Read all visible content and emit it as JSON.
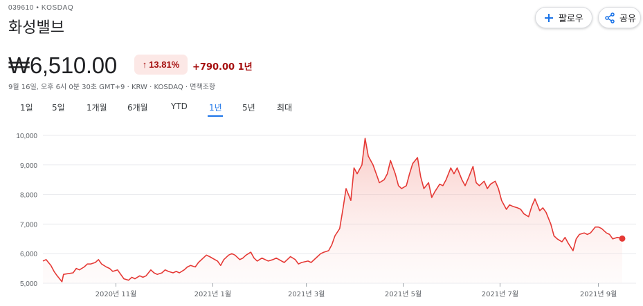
{
  "header": {
    "ticker": "039610 • KOSDAQ",
    "company": "화성밸브",
    "follow_label": "팔로우",
    "share_label": "공유"
  },
  "quote": {
    "price": "₩6,510.00",
    "percent": "13.81%",
    "change": "+790.00 1년",
    "timestamp": "9월 16일, 오후 6시 0분 30초 GMT+9 · KRW · KOSDAQ · 면책조항"
  },
  "tabs": [
    {
      "label": "1일",
      "active": false
    },
    {
      "label": "5일",
      "active": false
    },
    {
      "label": "1개월",
      "active": false
    },
    {
      "label": "6개월",
      "active": false
    },
    {
      "label": "YTD",
      "active": false
    },
    {
      "label": "1년",
      "active": true
    },
    {
      "label": "5년",
      "active": false
    },
    {
      "label": "최대",
      "active": false
    }
  ],
  "icons": {
    "follow": "plus-icon",
    "share": "share-icon",
    "trend": "arrow-up-icon"
  },
  "colors": {
    "line": "#e53935",
    "fill": "#fce8e6",
    "negative_text": "#a50e0e",
    "active_tab": "#1a73e8"
  },
  "chart_data": {
    "type": "area",
    "ylim": [
      5000,
      10000
    ],
    "yticks": [
      5000,
      6000,
      7000,
      8000,
      9000,
      10000
    ],
    "ytick_labels": [
      "5,000",
      "6,000",
      "7,000",
      "8,000",
      "9,000",
      "10,000"
    ],
    "xlim": [
      "2020-09-16",
      "2021-09-16"
    ],
    "xticks": [
      {
        "date": "2020-11-01",
        "label": "2020년 11월"
      },
      {
        "date": "2021-01-01",
        "label": "2021년 1월"
      },
      {
        "date": "2021-03-01",
        "label": "2021년 3월"
      },
      {
        "date": "2021-05-01",
        "label": "2021년 5월"
      },
      {
        "date": "2021-07-01",
        "label": "2021년 7월"
      },
      {
        "date": "2021-09-01",
        "label": "2021년 9월"
      }
    ],
    "grid": true,
    "series": [
      {
        "points": [
          [
            "2020-09-16",
            5750
          ],
          [
            "2020-09-18",
            5800
          ],
          [
            "2020-09-21",
            5600
          ],
          [
            "2020-09-23",
            5400
          ],
          [
            "2020-09-25",
            5250
          ],
          [
            "2020-09-28",
            5050
          ],
          [
            "2020-09-29",
            5300
          ],
          [
            "2020-10-05",
            5350
          ],
          [
            "2020-10-07",
            5500
          ],
          [
            "2020-10-09",
            5450
          ],
          [
            "2020-10-12",
            5550
          ],
          [
            "2020-10-14",
            5650
          ],
          [
            "2020-10-16",
            5650
          ],
          [
            "2020-10-19",
            5700
          ],
          [
            "2020-10-21",
            5800
          ],
          [
            "2020-10-23",
            5650
          ],
          [
            "2020-10-26",
            5550
          ],
          [
            "2020-10-28",
            5500
          ],
          [
            "2020-10-30",
            5400
          ],
          [
            "2020-11-02",
            5450
          ],
          [
            "2020-11-04",
            5300
          ],
          [
            "2020-11-06",
            5150
          ],
          [
            "2020-11-09",
            5100
          ],
          [
            "2020-11-11",
            5200
          ],
          [
            "2020-11-13",
            5150
          ],
          [
            "2020-11-16",
            5250
          ],
          [
            "2020-11-18",
            5200
          ],
          [
            "2020-11-20",
            5250
          ],
          [
            "2020-11-23",
            5450
          ],
          [
            "2020-11-25",
            5350
          ],
          [
            "2020-11-27",
            5300
          ],
          [
            "2020-11-30",
            5350
          ],
          [
            "2020-12-02",
            5450
          ],
          [
            "2020-12-04",
            5400
          ],
          [
            "2020-12-07",
            5350
          ],
          [
            "2020-12-09",
            5400
          ],
          [
            "2020-12-11",
            5350
          ],
          [
            "2020-12-14",
            5450
          ],
          [
            "2020-12-16",
            5550
          ],
          [
            "2020-12-18",
            5600
          ],
          [
            "2020-12-21",
            5550
          ],
          [
            "2020-12-23",
            5700
          ],
          [
            "2020-12-28",
            5950
          ],
          [
            "2020-12-30",
            5900
          ],
          [
            "2021-01-04",
            5750
          ],
          [
            "2021-01-06",
            5600
          ],
          [
            "2021-01-08",
            5800
          ],
          [
            "2021-01-11",
            5950
          ],
          [
            "2021-01-13",
            6000
          ],
          [
            "2021-01-15",
            5950
          ],
          [
            "2021-01-18",
            5800
          ],
          [
            "2021-01-20",
            5850
          ],
          [
            "2021-01-22",
            5950
          ],
          [
            "2021-01-25",
            6050
          ],
          [
            "2021-01-27",
            5850
          ],
          [
            "2021-01-29",
            5750
          ],
          [
            "2021-02-01",
            5850
          ],
          [
            "2021-02-03",
            5800
          ],
          [
            "2021-02-05",
            5750
          ],
          [
            "2021-02-08",
            5800
          ],
          [
            "2021-02-10",
            5850
          ],
          [
            "2021-02-15",
            5700
          ],
          [
            "2021-02-17",
            5800
          ],
          [
            "2021-02-19",
            5900
          ],
          [
            "2021-02-22",
            5800
          ],
          [
            "2021-02-24",
            5650
          ],
          [
            "2021-02-26",
            5700
          ],
          [
            "2021-03-02",
            5750
          ],
          [
            "2021-03-04",
            5700
          ],
          [
            "2021-03-08",
            5900
          ],
          [
            "2021-03-10",
            6000
          ],
          [
            "2021-03-12",
            6050
          ],
          [
            "2021-03-15",
            6100
          ],
          [
            "2021-03-17",
            6300
          ],
          [
            "2021-03-19",
            6600
          ],
          [
            "2021-03-22",
            6850
          ],
          [
            "2021-03-24",
            7500
          ],
          [
            "2021-03-26",
            8200
          ],
          [
            "2021-03-29",
            7800
          ],
          [
            "2021-03-31",
            8900
          ],
          [
            "2021-04-02",
            8700
          ],
          [
            "2021-04-05",
            9000
          ],
          [
            "2021-04-07",
            9900
          ],
          [
            "2021-04-09",
            9300
          ],
          [
            "2021-04-12",
            9000
          ],
          [
            "2021-04-14",
            8700
          ],
          [
            "2021-04-16",
            8400
          ],
          [
            "2021-04-19",
            8500
          ],
          [
            "2021-04-21",
            8700
          ],
          [
            "2021-04-23",
            9150
          ],
          [
            "2021-04-26",
            8700
          ],
          [
            "2021-04-28",
            8300
          ],
          [
            "2021-04-30",
            8200
          ],
          [
            "2021-05-03",
            8300
          ],
          [
            "2021-05-05",
            8700
          ],
          [
            "2021-05-07",
            9050
          ],
          [
            "2021-05-10",
            9250
          ],
          [
            "2021-05-12",
            8600
          ],
          [
            "2021-05-14",
            8200
          ],
          [
            "2021-05-17",
            8400
          ],
          [
            "2021-05-19",
            7900
          ],
          [
            "2021-05-21",
            8100
          ],
          [
            "2021-05-24",
            8350
          ],
          [
            "2021-05-26",
            8300
          ],
          [
            "2021-05-28",
            8500
          ],
          [
            "2021-05-31",
            8900
          ],
          [
            "2021-06-02",
            8700
          ],
          [
            "2021-06-04",
            8900
          ],
          [
            "2021-06-07",
            8500
          ],
          [
            "2021-06-09",
            8300
          ],
          [
            "2021-06-11",
            8550
          ],
          [
            "2021-06-14",
            8950
          ],
          [
            "2021-06-16",
            8400
          ],
          [
            "2021-06-18",
            8300
          ],
          [
            "2021-06-21",
            8450
          ],
          [
            "2021-06-23",
            8200
          ],
          [
            "2021-06-25",
            8350
          ],
          [
            "2021-06-28",
            8450
          ],
          [
            "2021-06-30",
            8200
          ],
          [
            "2021-07-02",
            7800
          ],
          [
            "2021-07-05",
            7500
          ],
          [
            "2021-07-07",
            7650
          ],
          [
            "2021-07-09",
            7600
          ],
          [
            "2021-07-12",
            7550
          ],
          [
            "2021-07-14",
            7500
          ],
          [
            "2021-07-16",
            7350
          ],
          [
            "2021-07-19",
            7250
          ],
          [
            "2021-07-21",
            7600
          ],
          [
            "2021-07-23",
            7850
          ],
          [
            "2021-07-26",
            7450
          ],
          [
            "2021-07-28",
            7550
          ],
          [
            "2021-07-30",
            7400
          ],
          [
            "2021-08-02",
            7000
          ],
          [
            "2021-08-04",
            6600
          ],
          [
            "2021-08-06",
            6500
          ],
          [
            "2021-08-09",
            6400
          ],
          [
            "2021-08-11",
            6550
          ],
          [
            "2021-08-13",
            6350
          ],
          [
            "2021-08-16",
            6100
          ],
          [
            "2021-08-18",
            6500
          ],
          [
            "2021-08-20",
            6650
          ],
          [
            "2021-08-23",
            6700
          ],
          [
            "2021-08-25",
            6650
          ],
          [
            "2021-08-27",
            6700
          ],
          [
            "2021-08-30",
            6900
          ],
          [
            "2021-09-01",
            6900
          ],
          [
            "2021-09-03",
            6850
          ],
          [
            "2021-09-06",
            6700
          ],
          [
            "2021-09-08",
            6650
          ],
          [
            "2021-09-10",
            6500
          ],
          [
            "2021-09-13",
            6550
          ],
          [
            "2021-09-16",
            6510
          ]
        ]
      }
    ]
  }
}
